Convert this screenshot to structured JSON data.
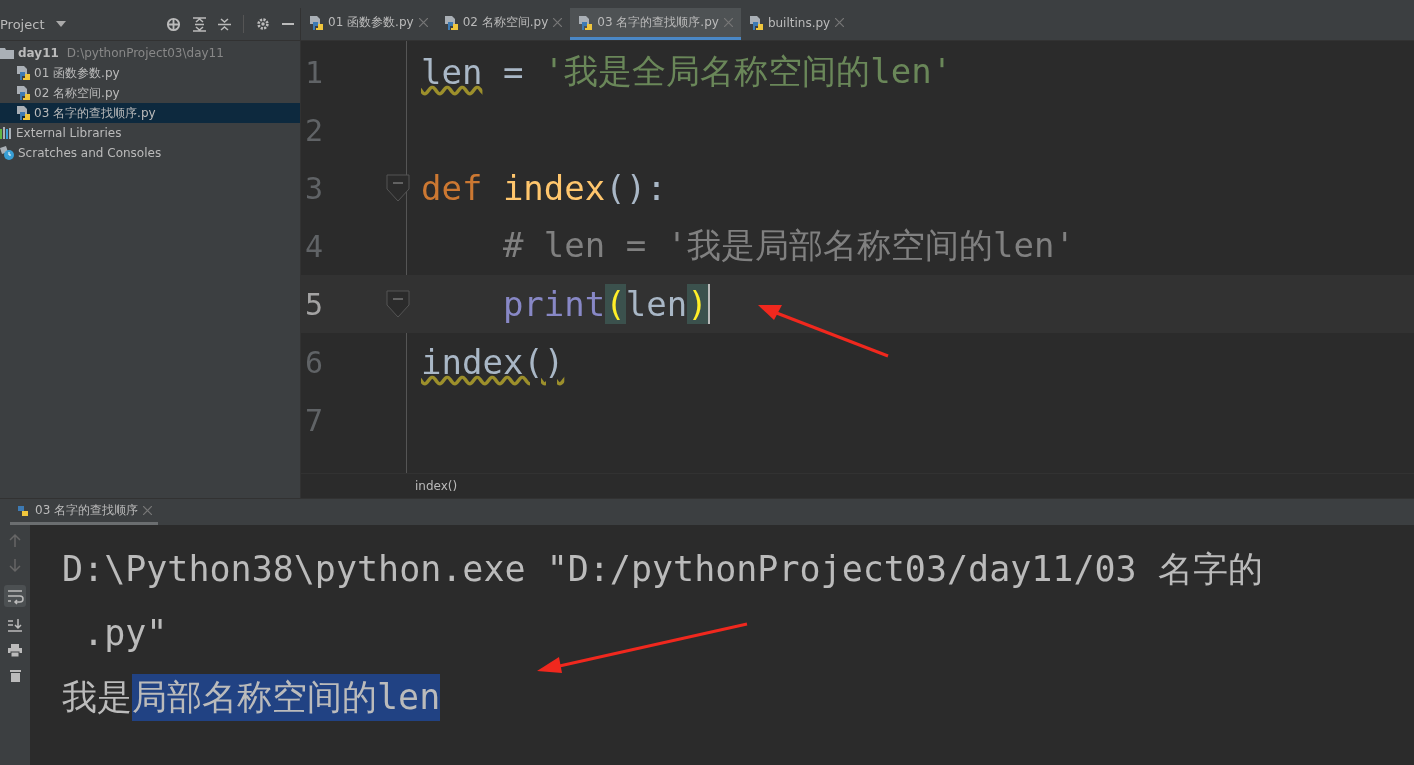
{
  "project_panel": {
    "title": "Project",
    "tree": [
      {
        "label": "day11",
        "path": "D:\\pythonProject03\\day11",
        "kind": "folder",
        "selected": false,
        "children": [
          {
            "label": "01 函数参数.py",
            "kind": "python",
            "selected": false
          },
          {
            "label": "02 名称空间.py",
            "kind": "python",
            "selected": false
          },
          {
            "label": "03 名字的查找顺序.py",
            "kind": "python",
            "selected": true
          }
        ]
      },
      {
        "label": "External Libraries",
        "kind": "library",
        "selected": false
      },
      {
        "label": "Scratches and Consoles",
        "kind": "scratch",
        "selected": false
      }
    ]
  },
  "editor_tabs": [
    {
      "label": "01 函数参数.py",
      "selected": false
    },
    {
      "label": "02 名称空间.py",
      "selected": false
    },
    {
      "label": "03 名字的查找顺序.py",
      "selected": true
    },
    {
      "label": "builtins.py",
      "selected": false
    }
  ],
  "code": [
    {
      "number": "1",
      "current": false,
      "fold": false,
      "tokens": [
        {
          "text": "len",
          "kind": "warn"
        },
        {
          "text": " = ",
          "kind": "plain"
        },
        {
          "text": "'我是全局名称空间的len'",
          "kind": "string"
        }
      ]
    },
    {
      "number": "2",
      "current": false,
      "fold": false
    },
    {
      "number": "3",
      "current": false,
      "fold": true,
      "tokens": [
        {
          "text": "def",
          "kind": "keyword"
        },
        {
          "text": " index",
          "kind": "func"
        },
        {
          "text": "():",
          "kind": "plain"
        }
      ]
    },
    {
      "number": "4",
      "current": false,
      "fold": false,
      "tokens": [
        {
          "text": "    # len = '我是局部名称空间的len'",
          "kind": "comment"
        }
      ]
    },
    {
      "number": "5",
      "current": true,
      "fold": true,
      "tokens": [
        {
          "text": "    print",
          "kind": "builtin"
        },
        {
          "text": "(",
          "kind": "brace"
        },
        {
          "text": "len",
          "kind": "plain"
        },
        {
          "text": ")",
          "kind": "brace"
        }
      ]
    },
    {
      "number": "6",
      "current": false,
      "fold": false,
      "tokens": [
        {
          "text": "index()",
          "kind": "warn"
        }
      ]
    },
    {
      "number": "7",
      "current": false,
      "fold": false
    }
  ],
  "breadcrumb": "index()",
  "run_panel": {
    "tab": "03 名字的查找顺序",
    "output": [
      [
        {
          "text": "D:\\Python38\\python.exe \"D:/pythonProject03/day11/03 名字的",
          "selected": false
        }
      ],
      [
        {
          "text": " .py\"",
          "selected": false
        }
      ],
      [
        {
          "text": "我是",
          "selected": false
        },
        {
          "text": "局部名称空间的len",
          "selected": true
        }
      ]
    ]
  }
}
